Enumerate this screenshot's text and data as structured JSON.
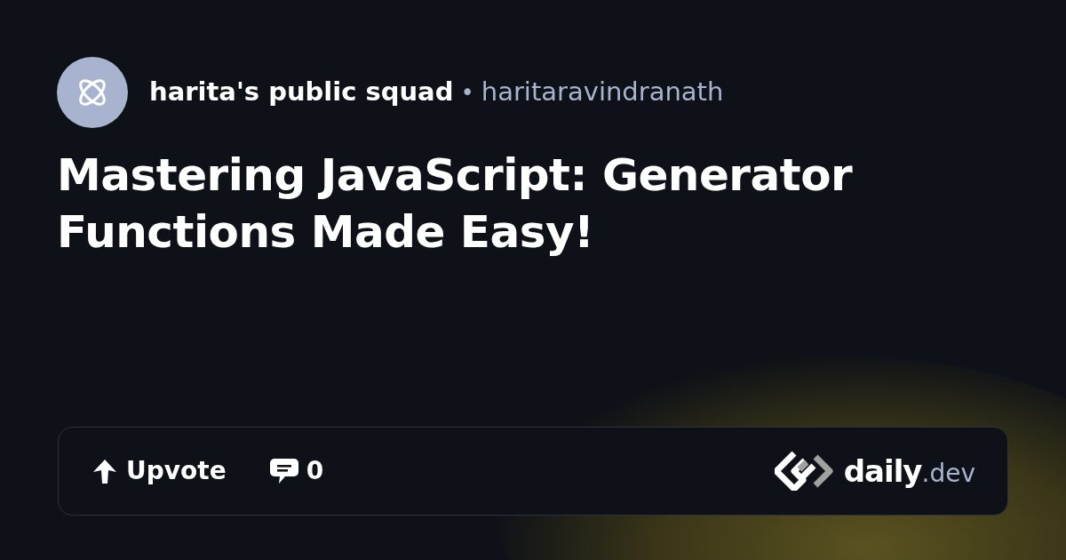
{
  "source": {
    "name": "harita's public squad",
    "separator": "•",
    "author": "haritaravindranath"
  },
  "title": "Mastering JavaScript: Generator Functions Made Easy!",
  "actions": [
    {
      "kind": "upvote",
      "label": "Upvote"
    },
    {
      "kind": "comments",
      "label": "0"
    }
  ],
  "brand": {
    "name": "daily",
    "suffix": ".dev"
  }
}
